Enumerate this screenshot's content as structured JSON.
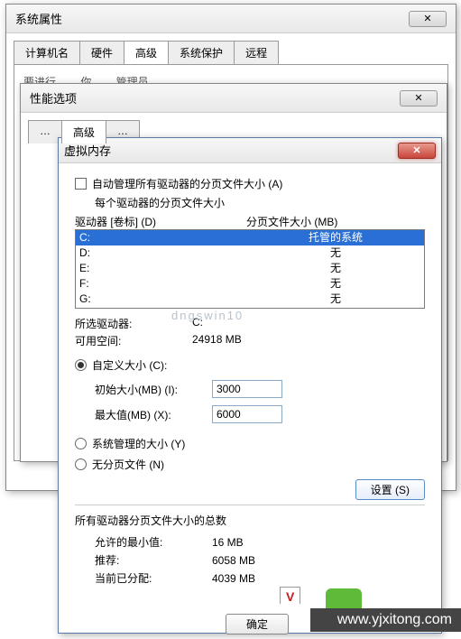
{
  "win1": {
    "title": "系统属性",
    "tabs": [
      "计算机名",
      "硬件",
      "高级",
      "系统保护",
      "远程"
    ],
    "active_tab": "高级",
    "note_partial": "要进行… …你… …管理员…"
  },
  "win2": {
    "title": "性能选项",
    "tabs_partial": [
      "…",
      "高级",
      "…"
    ]
  },
  "win3": {
    "title": "虚拟内存",
    "auto_manage_label": "自动管理所有驱动器的分页文件大小 (A)",
    "each_drive_label": "每个驱动器的分页文件大小",
    "col_drive": "驱动器 [卷标] (D)",
    "col_size": "分页文件大小 (MB)",
    "drives": [
      {
        "letter": "C:",
        "status": "托管的系统",
        "selected": true
      },
      {
        "letter": "D:",
        "status": "无",
        "selected": false
      },
      {
        "letter": "E:",
        "status": "无",
        "selected": false
      },
      {
        "letter": "F:",
        "status": "无",
        "selected": false
      },
      {
        "letter": "G:",
        "status": "无",
        "selected": false
      }
    ],
    "selected_drive_label": "所选驱动器:",
    "selected_drive_value": "C:",
    "available_label": "可用空间:",
    "available_value": "24918 MB",
    "custom_size_label": "自定义大小 (C):",
    "initial_label": "初始大小(MB) (I):",
    "initial_value": "3000",
    "max_label": "最大值(MB) (X):",
    "max_value": "6000",
    "system_managed_label": "系统管理的大小 (Y)",
    "no_paging_label": "无分页文件 (N)",
    "set_button": "设置 (S)",
    "totals_head": "所有驱动器分页文件大小的总数",
    "min_allowed_label": "允许的最小值:",
    "min_allowed_value": "16 MB",
    "recommended_label": "推荐:",
    "recommended_value": "6058 MB",
    "allocated_label": "当前已分配:",
    "allocated_value": "4039 MB"
  },
  "buttons": {
    "ok": "确定"
  },
  "misc": {
    "red_v": "V",
    "url": "www.yjxitong.com",
    "watermark": "dngswin10"
  }
}
